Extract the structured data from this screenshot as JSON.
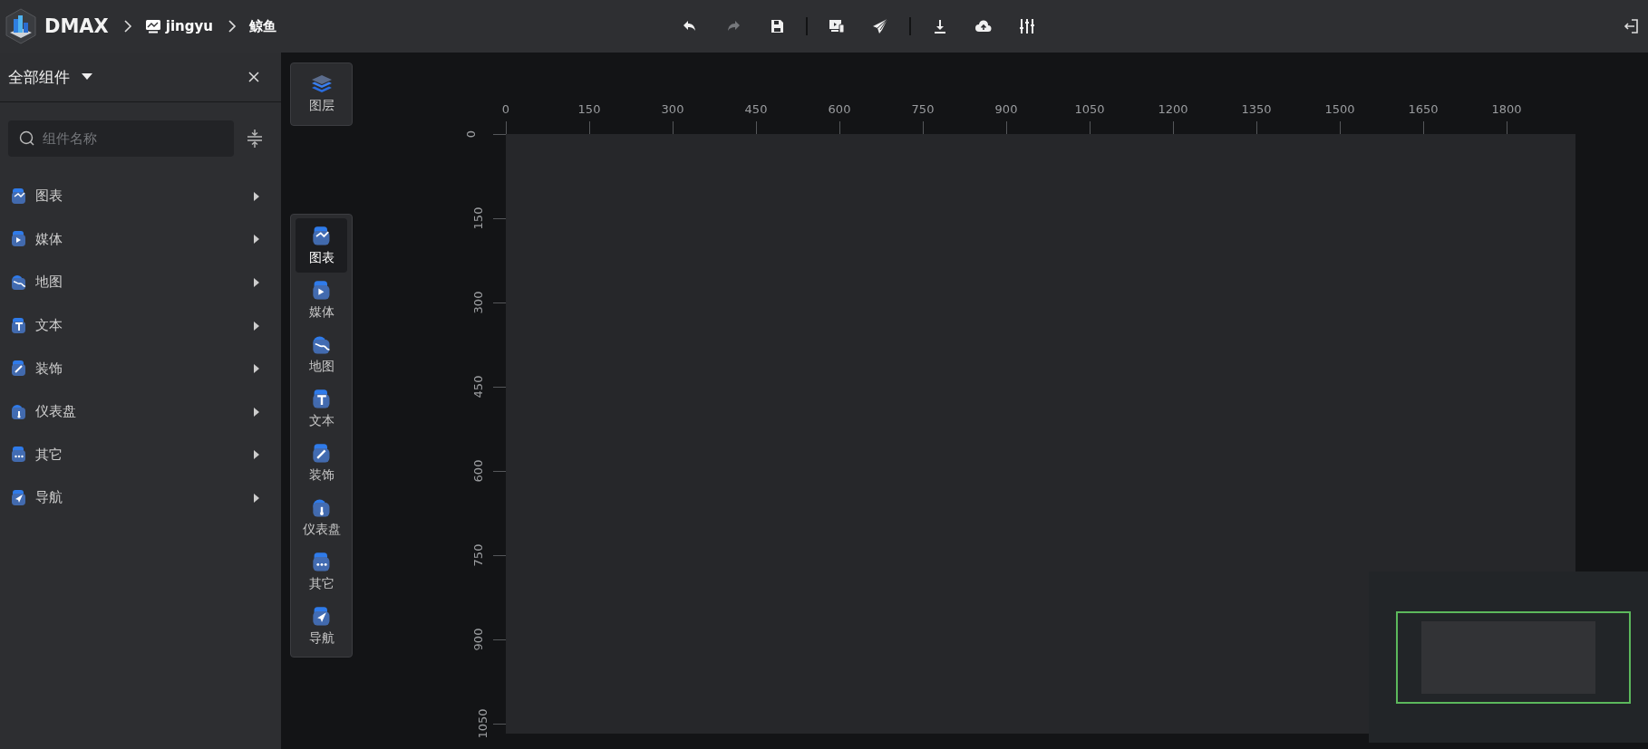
{
  "header": {
    "logo": "DMAX",
    "breadcrumb": [
      {
        "label": "jingyu",
        "kind": "project"
      },
      {
        "label": "鲸鱼",
        "kind": "page"
      }
    ],
    "toolbar": [
      {
        "kind": "undo",
        "disabled": false
      },
      {
        "kind": "redo",
        "disabled": true
      },
      {
        "kind": "save",
        "disabled": false
      },
      {
        "kind": "separator"
      },
      {
        "kind": "preview",
        "disabled": false
      },
      {
        "kind": "publish",
        "disabled": false
      },
      {
        "kind": "separator"
      },
      {
        "kind": "download",
        "disabled": false
      },
      {
        "kind": "upload",
        "disabled": false
      },
      {
        "kind": "settings",
        "disabled": false
      }
    ]
  },
  "sidebar": {
    "title": "全部组件",
    "search": {
      "placeholder": "组件名称"
    },
    "items": [
      {
        "label": "图表"
      },
      {
        "label": "媒体"
      },
      {
        "label": "地图"
      },
      {
        "label": "文本"
      },
      {
        "label": "装饰"
      },
      {
        "label": "仪表盘"
      },
      {
        "label": "其它"
      },
      {
        "label": "导航"
      }
    ]
  },
  "dock": {
    "layers": {
      "label": "图层"
    },
    "items": [
      {
        "label": "图表",
        "selected": true
      },
      {
        "label": "媒体",
        "selected": false
      },
      {
        "label": "地图",
        "selected": false
      },
      {
        "label": "文本",
        "selected": false
      },
      {
        "label": "装饰",
        "selected": false
      },
      {
        "label": "仪表盘",
        "selected": false
      },
      {
        "label": "其它",
        "selected": false
      },
      {
        "label": "导航",
        "selected": false
      }
    ]
  },
  "ruler": {
    "x_labels": [
      "0",
      "150",
      "300",
      "450",
      "600",
      "750",
      "900",
      "1050",
      "1200",
      "1350",
      "1500",
      "1650",
      "1800"
    ],
    "y_labels": [
      "0",
      "150",
      "300",
      "450",
      "600",
      "750",
      "900",
      "1050"
    ]
  }
}
